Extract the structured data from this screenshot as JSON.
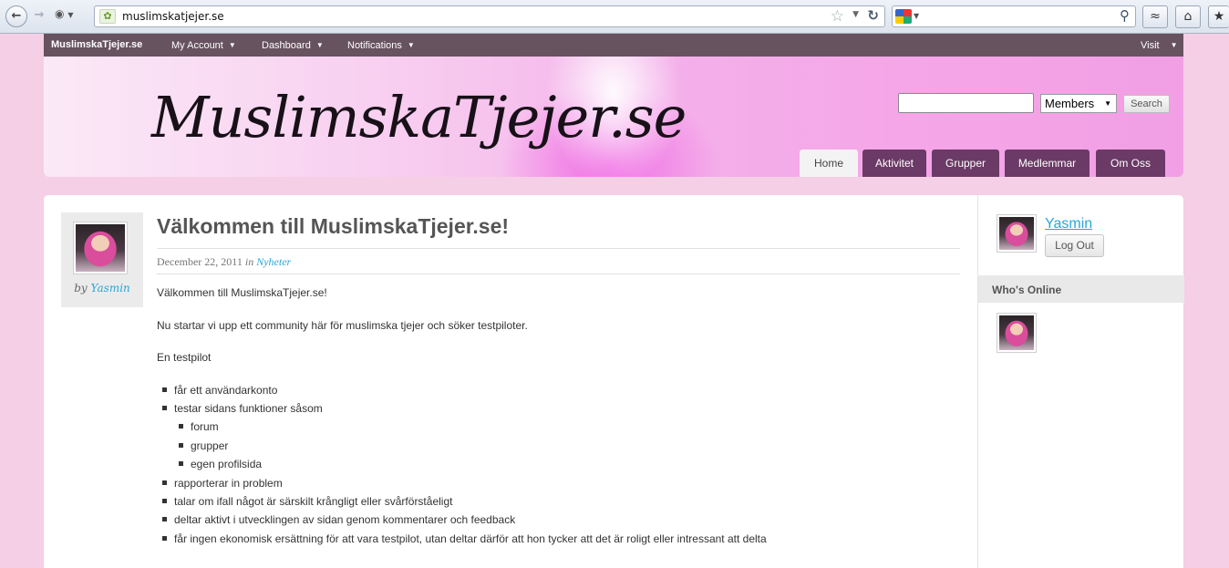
{
  "browser": {
    "url": "muslimskatjejer.se",
    "search_placeholder": ""
  },
  "adminbar": {
    "brand": "MuslimskaTjejer.se",
    "menus": [
      "My Account",
      "Dashboard",
      "Notifications"
    ],
    "visit": "Visit"
  },
  "header": {
    "logo": "MuslimskaTjejer.se",
    "search_select": "Members",
    "search_button": "Search",
    "tabs": [
      "Home",
      "Aktivitet",
      "Grupper",
      "Medlemmar",
      "Om Oss"
    ],
    "active_tab": "Home"
  },
  "post": {
    "title": "Välkommen till MuslimskaTjejer.se!",
    "date": "December 22, 2011",
    "in_word": "in",
    "category": "Nyheter",
    "by_word": "by",
    "author": "Yasmin",
    "paragraphs": [
      "Välkommen till MuslimskaTjejer.se!",
      "Nu startar vi upp ett community här för muslimska tjejer och söker testpiloter.",
      "En testpilot"
    ],
    "list": [
      "får ett användarkonto",
      "testar sidans funktioner såsom",
      "rapporterar in problem",
      "talar om ifall något är särskilt krångligt eller svårförståeligt",
      "deltar aktivt i utvecklingen av sidan genom kommentarer och feedback",
      "får ingen ekonomisk ersättning för att vara testpilot, utan deltar därför att hon tycker att det är roligt eller intressant att delta"
    ],
    "sublist": [
      "forum",
      "grupper",
      "egen profilsida"
    ]
  },
  "sidebar": {
    "username": "Yasmin",
    "logout": "Log Out",
    "whos_online_title": "Who's Online"
  },
  "colors": {
    "adminbar": "#67525f",
    "tab": "#6b3a66",
    "link": "#2aa6d6",
    "page_bg": "#f5cfe6"
  }
}
